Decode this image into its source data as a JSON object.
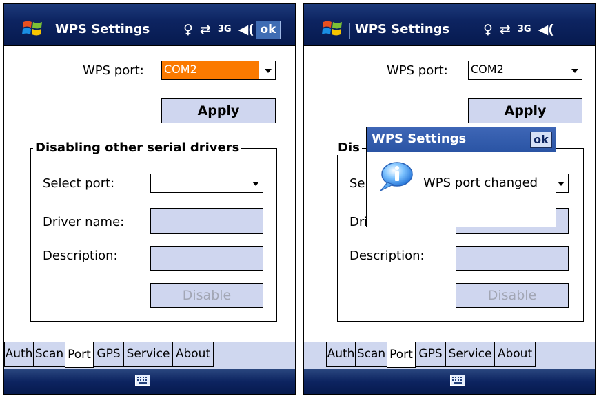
{
  "screens": [
    {
      "title": "WPS Settings",
      "ok_label": "ok",
      "status_icons": [
        "signal-icon",
        "sync-icon",
        "3g-icon",
        "speaker-icon"
      ],
      "wps_port_label": "WPS port:",
      "wps_port_value": "COM2",
      "wps_port_selected": true,
      "apply_label": "Apply",
      "group_title": "Disabling other serial drivers",
      "select_port_label": "Select port:",
      "driver_name_label": "Driver name:",
      "description_label": "Description:",
      "disable_label": "Disable",
      "tabs": [
        "Auth",
        "Scan",
        "Port",
        "GPS",
        "Service",
        "About"
      ],
      "active_tab": "Port"
    },
    {
      "title": "WPS Settings",
      "wps_port_label": "WPS port:",
      "wps_port_value": "COM2",
      "wps_port_selected": false,
      "apply_label": "Apply",
      "group_title_partial": "Dis",
      "select_port_partial": "Se",
      "driver_name_partial": "Dri",
      "description_label": "Description:",
      "disable_label": "Disable",
      "tabs": [
        "Auth",
        "Scan",
        "Port",
        "GPS",
        "Service",
        "About"
      ],
      "active_tab": "Port",
      "dialog": {
        "title": "WPS Settings",
        "ok_label": "ok",
        "message": "WPS port changed",
        "icon": "info-icon"
      }
    }
  ],
  "colors": {
    "titlebar": "#0d2461",
    "selection": "#fb7a00",
    "control_fill": "#cfd6ef",
    "dialog_title": "#3e66b6"
  }
}
